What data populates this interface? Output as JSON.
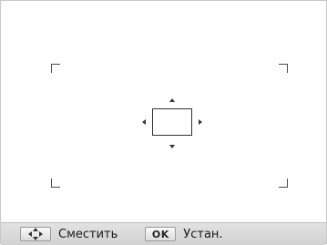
{
  "viewfinder": {
    "af_frame": "focus-area-box"
  },
  "bottom_bar": {
    "nav_key_icon": "directional-pad-icon",
    "move_label": "Сместить",
    "ok_key_label": "OK",
    "set_label": "Устан."
  }
}
